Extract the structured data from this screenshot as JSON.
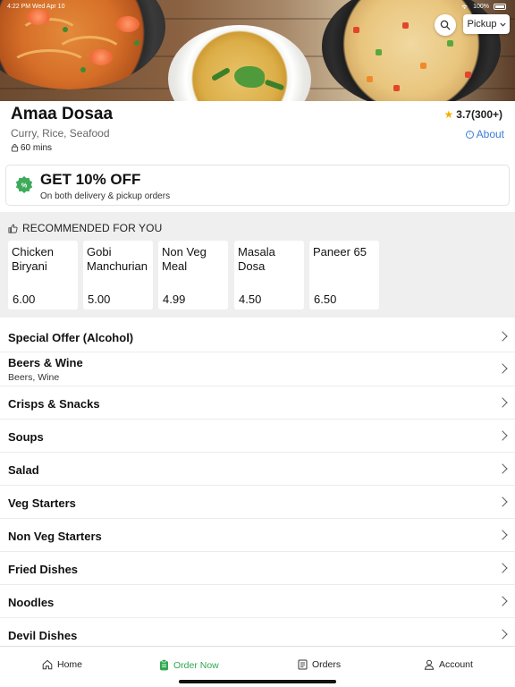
{
  "status_bar": {
    "time": "4:22 PM  Wed Apr 10",
    "battery": "100%"
  },
  "header": {
    "pickup_label": "Pickup"
  },
  "restaurant": {
    "name": "Amaa Dosaa",
    "rating": "3.7(300+)",
    "cuisine": "Curry, Rice, Seafood",
    "about_label": "About",
    "eta": "60 mins"
  },
  "offer": {
    "title": "GET 10% OFF",
    "subtitle": "On both delivery & pickup orders"
  },
  "recommended": {
    "heading": "RECOMMENDED FOR YOU",
    "items": [
      {
        "name": "Chicken Biryani",
        "price": "6.00"
      },
      {
        "name": "Gobi Manchurian",
        "price": "5.00"
      },
      {
        "name": "Non Veg Meal",
        "price": "4.99"
      },
      {
        "name": "Masala Dosa",
        "price": "4.50"
      },
      {
        "name": "Paneer 65",
        "price": "6.50"
      }
    ]
  },
  "categories": [
    {
      "label": "Special Offer (Alcohol)",
      "sub": ""
    },
    {
      "label": "Beers & Wine",
      "sub": "Beers, Wine"
    },
    {
      "label": "Crisps & Snacks",
      "sub": ""
    },
    {
      "label": "Soups",
      "sub": ""
    },
    {
      "label": "Salad",
      "sub": ""
    },
    {
      "label": "Veg Starters",
      "sub": ""
    },
    {
      "label": "Non Veg Starters",
      "sub": ""
    },
    {
      "label": "Fried Dishes",
      "sub": ""
    },
    {
      "label": "Noodles",
      "sub": ""
    },
    {
      "label": "Devil Dishes",
      "sub": ""
    }
  ],
  "bottom_nav": {
    "home": "Home",
    "order_now": "Order Now",
    "orders": "Orders",
    "account": "Account"
  },
  "colors": {
    "accent_green": "#2fa84f",
    "link_blue": "#3a7bd5",
    "star": "#f2b100"
  },
  "icons": [
    "search-icon",
    "chevron-down-icon",
    "star-icon",
    "info-icon",
    "bag-icon",
    "discount-badge-icon",
    "thumbs-up-icon",
    "chevron-right-icon",
    "home-icon",
    "order-icon",
    "orders-icon",
    "account-icon",
    "wifi-icon",
    "battery-icon"
  ]
}
